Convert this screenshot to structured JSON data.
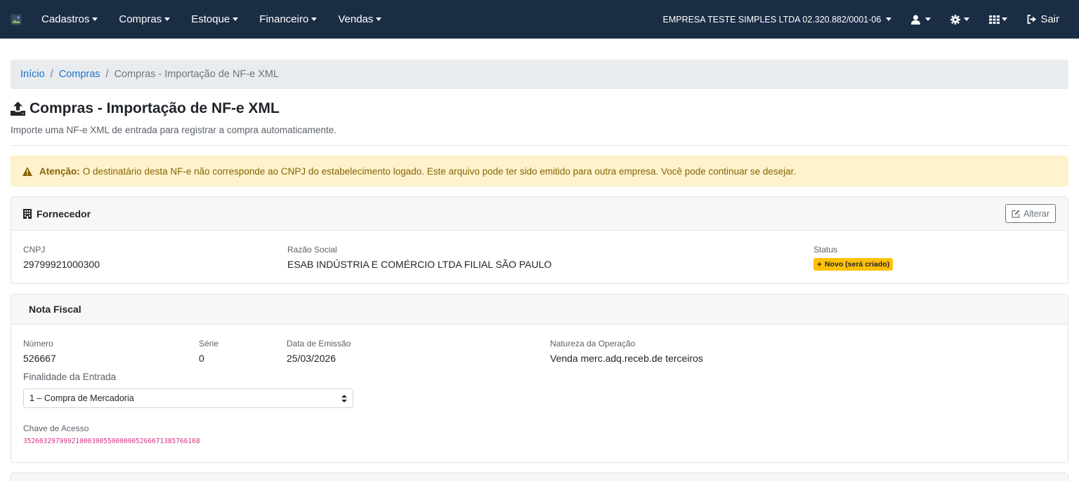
{
  "nav": {
    "items": [
      "Cadastros",
      "Compras",
      "Estoque",
      "Financeiro",
      "Vendas"
    ],
    "company": "EMPRESA TESTE SIMPLES LTDA 02.320.882/0001-06",
    "logout": "Sair"
  },
  "breadcrumb": {
    "home": "Início",
    "section": "Compras",
    "current": "Compras - Importação de NF-e XML"
  },
  "page": {
    "title": "Compras - Importação de NF-e XML",
    "subtitle": "Importe uma NF-e XML de entrada para registrar a compra automaticamente."
  },
  "alert": {
    "label": "Atenção:",
    "message": "O destinatário desta NF-e não corresponde ao CNPJ do estabelecimento logado. Este arquivo pode ter sido emitido para outra empresa. Você pode continuar se desejar."
  },
  "supplier": {
    "header": "Fornecedor",
    "edit_label": "Alterar",
    "cnpj_label": "CNPJ",
    "cnpj": "29799921000300",
    "name_label": "Razão Social",
    "name": "ESAB INDÚSTRIA E COMÉRCIO LTDA FILIAL SÃO PAULO",
    "status_label": "Status",
    "status": "Novo (será criado)"
  },
  "invoice": {
    "header": "Nota Fiscal",
    "number_label": "Número",
    "number": "526667",
    "series_label": "Série",
    "series": "0",
    "date_label": "Data de Emissão",
    "date": "25/03/2026",
    "nature_label": "Natureza da Operação",
    "nature": "Venda merc.adq.receb.de terceiros",
    "purpose_label": "Finalidade da Entrada",
    "purpose": "1 – Compra de Mercadoria",
    "key_label": "Chave de Acesso",
    "key": "35260329799921000300550000005266671385766168"
  },
  "colors": {
    "navbar": "#1b2d45",
    "link": "#1a73c9",
    "warning_bg": "#fff3cd",
    "warning_text": "#856404",
    "badge": "#ffc107",
    "key_text": "#d63384"
  }
}
